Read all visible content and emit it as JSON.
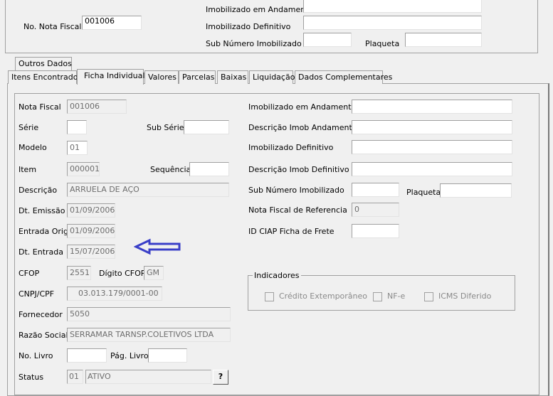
{
  "header": {
    "nota_fiscal_label": "No. Nota Fiscal",
    "nota_fiscal_value": "001006",
    "imob_andamento_label": "Imobilizado em Andamento",
    "imob_andamento_value": "",
    "imob_definitivo_label": "Imobilizado Definitivo",
    "imob_definitivo_value": "",
    "sub_numero_label": "Sub Número Imobilizado",
    "sub_numero_value": "",
    "plaqueta_label": "Plaqueta",
    "plaqueta_value": ""
  },
  "tabs": {
    "row1": [
      "Outros Dados"
    ],
    "row2": [
      "Itens Encontrados",
      "Ficha Individual",
      "Valores",
      "Parcelas",
      "Baixas",
      "Liquidação",
      "Dados Complementares"
    ],
    "selected": "Ficha Individual"
  },
  "form": {
    "nota_fiscal": {
      "label": "Nota Fiscal",
      "value": "001006"
    },
    "serie": {
      "label": "Série",
      "value": ""
    },
    "sub_serie": {
      "label": "Sub Série",
      "value": ""
    },
    "modelo": {
      "label": "Modelo",
      "value": "01"
    },
    "item": {
      "label": "Item",
      "value": "000001"
    },
    "sequencia": {
      "label": "Sequência",
      "value": ""
    },
    "descricao": {
      "label": "Descrição",
      "value": "ARRUELA DE AÇO"
    },
    "dt_emissao": {
      "label": "Dt. Emissão",
      "value": "01/09/2006"
    },
    "entrada_orig": {
      "label": "Entrada Orig",
      "value": "01/09/2006"
    },
    "dt_entrada": {
      "label": "Dt. Entrada",
      "value": "15/07/2006"
    },
    "cfop": {
      "label": "CFOP",
      "value": "2551"
    },
    "digito_cfop": {
      "label": "Dígito CFOP",
      "value": "GM"
    },
    "cnpj": {
      "label": "CNPJ/CPF",
      "value": "03.013.179/0001-00"
    },
    "fornecedor": {
      "label": "Fornecedor",
      "value": "5050"
    },
    "razao_social": {
      "label": "Razão Social",
      "value": "SERRAMAR TARNSP.COLETIVOS LTDA"
    },
    "no_livro": {
      "label": "No. Livro",
      "value": ""
    },
    "pag_livro": {
      "label": "Pág. Livro",
      "value": ""
    },
    "status": {
      "label": "Status",
      "code": "01",
      "value": "ATIVO",
      "help": "?"
    },
    "imob_andamento": {
      "label": "Imobilizado em Andamento",
      "value": ""
    },
    "desc_imob_andamento": {
      "label": "Descrição Imob Andamento",
      "value": ""
    },
    "imob_definitivo": {
      "label": "Imobilizado Definitivo",
      "value": ""
    },
    "desc_imob_definitivo": {
      "label": "Descrição Imob Definitivo",
      "value": ""
    },
    "sub_numero": {
      "label": "Sub Número Imobilizado",
      "value": ""
    },
    "plaqueta": {
      "label": "Plaqueta",
      "value": ""
    },
    "nf_referencia": {
      "label": "Nota Fiscal de Referencia",
      "value": "0"
    },
    "id_ciap": {
      "label": "ID CIAP Ficha de Frete",
      "value": ""
    }
  },
  "indicadores": {
    "title": "Indicadores",
    "items": [
      {
        "label": "Crédito Extemporâneo",
        "checked": false
      },
      {
        "label": "NF-e",
        "checked": false
      },
      {
        "label": "ICMS Diferido",
        "checked": false
      }
    ]
  },
  "colors": {
    "arrow": "#3a3fc8"
  }
}
